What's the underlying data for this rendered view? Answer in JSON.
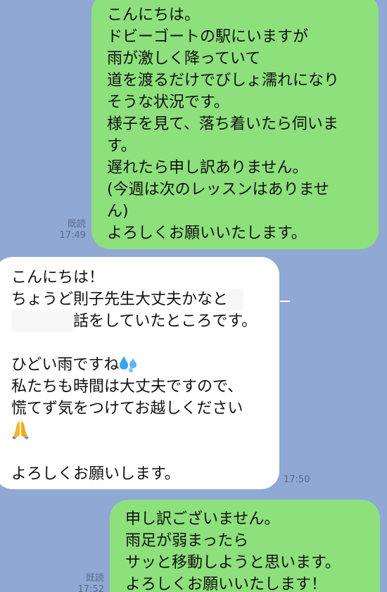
{
  "messages": [
    {
      "lines": [
        "こんにちは。",
        "ドビーゴートの駅にいますが",
        "雨が激しく降っていて",
        "道を渡るだけでびしょ濡れになり",
        "そうな状況です。",
        "様子を見て、落ち着いたら伺いま",
        "す。",
        "遅れたら申し訳ありません。",
        "(今週は次のレッスンはありませ",
        "ん)",
        "よろしくお願いいたします。"
      ],
      "read_label": "既読",
      "time": "17:49"
    },
    {
      "line1": "こんにちは！",
      "line2_text": "ちょうど則子先生大丈夫かなと",
      "line2_redacted": "・",
      "line3_redacted": "・・・・",
      "line3_text": "話をしていたところです。",
      "line4": "",
      "line5_text": "ひどい雨ですね",
      "line5_emoji": "sweat-droplets-icon",
      "line6": "私たちも時間は大丈夫ですので、",
      "line7": "慌てず気をつけてお越しください",
      "line8_emoji": "folded-hands-icon",
      "line9": "",
      "line10": "よろしくお願いします。",
      "time": "17:50"
    },
    {
      "lines": [
        "申し訳ございません。",
        "雨足が弱まったら",
        "サッと移動しようと思います。",
        "よろしくお願いいたします！"
      ],
      "read_label": "既読",
      "time": "17:52"
    }
  ],
  "colors": {
    "background": "#8fa8d4",
    "sent_bubble": "#8de07c",
    "received_bubble": "#ffffff",
    "meta_text": "#5b6a86"
  }
}
